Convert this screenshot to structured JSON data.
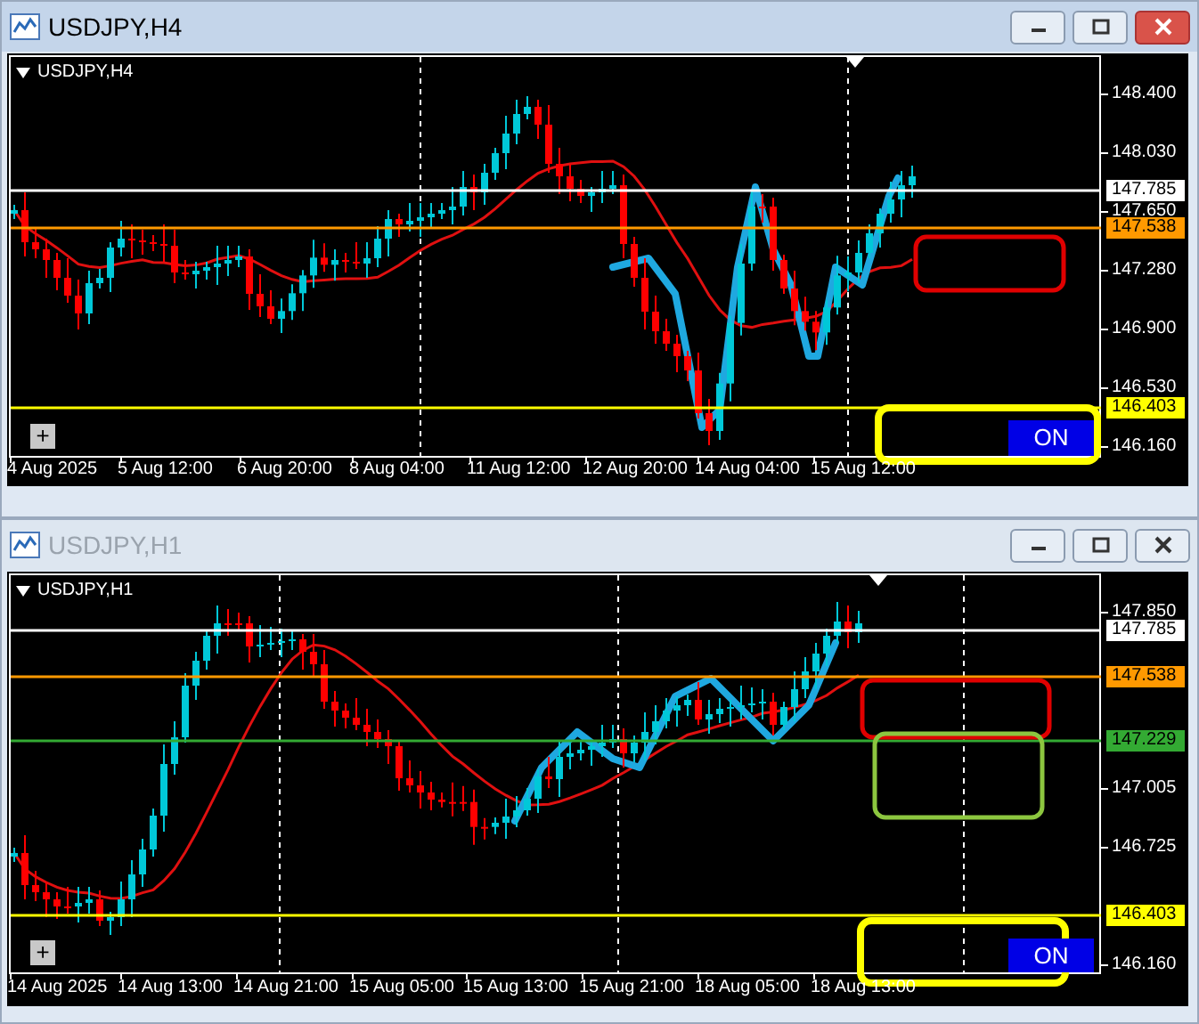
{
  "windows": [
    {
      "title": "USDJPY,H4",
      "active": true,
      "chart_label": "USDJPY,H4",
      "zoom_button": "+",
      "price_ticks": [
        "148.400",
        "148.030",
        "147.650",
        "147.280",
        "146.900",
        "146.530",
        "146.160"
      ],
      "price_levels": [
        {
          "label": "147.785",
          "color": "#ffffff"
        },
        {
          "label": "147.538",
          "color": "#ff9900"
        },
        {
          "label": "146.403",
          "color": "#ffff00"
        }
      ],
      "time_labels": [
        "4 Aug 2025",
        "5 Aug 12:00",
        "6 Aug 20:00",
        "8 Aug 04:00",
        "11 Aug 12:00",
        "12 Aug 20:00",
        "14 Aug 04:00",
        "15 Aug 12:00"
      ],
      "zones": [
        {
          "color": "#e00000"
        },
        {
          "color": "#ffff00"
        }
      ],
      "button": {
        "label": "ON"
      }
    },
    {
      "title": "USDJPY,H1",
      "active": false,
      "chart_label": "USDJPY,H1",
      "zoom_button": "+",
      "price_ticks": [
        "147.850",
        "147.005",
        "146.725",
        "146.160"
      ],
      "price_levels": [
        {
          "label": "147.785",
          "color": "#ffffff"
        },
        {
          "label": "147.538",
          "color": "#ff9900"
        },
        {
          "label": "147.229",
          "color": "#33aa33"
        },
        {
          "label": "146.403",
          "color": "#ffff00"
        }
      ],
      "time_labels": [
        "14 Aug 2025",
        "14 Aug 13:00",
        "14 Aug 21:00",
        "15 Aug 05:00",
        "15 Aug 13:00",
        "15 Aug 21:00",
        "18 Aug 05:00",
        "18 Aug 13:00"
      ],
      "zones": [
        {
          "color": "#e00000"
        },
        {
          "color": "#8cc63f"
        },
        {
          "color": "#ffff00"
        }
      ],
      "button": {
        "label": "ON"
      }
    }
  ]
}
